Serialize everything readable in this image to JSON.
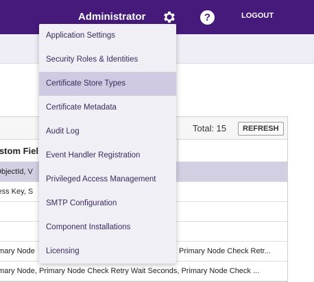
{
  "header": {
    "user_name": "Administrator",
    "logout_label": "LOGOUT",
    "help_glyph": "?",
    "icons": [
      "gear-icon",
      "help-icon"
    ],
    "brand_color": "#451a7a"
  },
  "grid": {
    "total_label": "Total: 15",
    "refresh_label": "REFRESH",
    "column_header": "ustom Fiel",
    "rows": [
      {
        "c1": "lObjectId, V",
        "c2": "",
        "selected": true
      },
      {
        "c1": "cess Key, S",
        "c2": ""
      },
      {
        "c1": "",
        "c2": ""
      },
      {
        "c1": "",
        "c2": ""
      },
      {
        "c1": "rimary Node",
        "c2": "Primary Node Check Retr..."
      },
      {
        "c1": "rimary Node, Primary Node Check Retry Wait Seconds, Primary Node Check ...",
        "c2": ""
      }
    ]
  },
  "menu": {
    "items": [
      {
        "label": "Application Settings"
      },
      {
        "label": "Security Roles & Identities"
      },
      {
        "label": "Certificate Store Types",
        "active": true
      },
      {
        "label": "Certificate Metadata"
      },
      {
        "label": "Audit Log"
      },
      {
        "label": "Event Handler Registration"
      },
      {
        "label": "Privileged Access Management"
      },
      {
        "label": "SMTP Configuration"
      },
      {
        "label": "Component Installations"
      },
      {
        "label": "Licensing"
      }
    ]
  }
}
